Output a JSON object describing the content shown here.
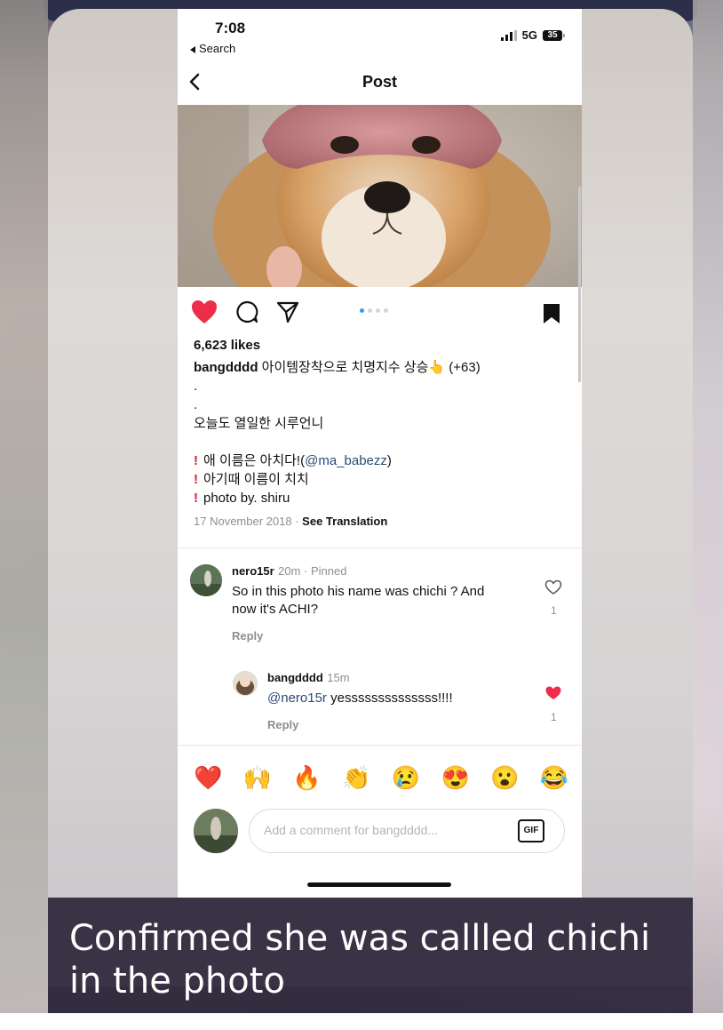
{
  "status_bar": {
    "time": "7:08",
    "back_app": "Search",
    "network": "5G",
    "battery": "35"
  },
  "nav": {
    "title": "Post"
  },
  "post": {
    "likes": "6,623 likes",
    "carousel": {
      "count": 4,
      "active_index": 0
    },
    "liked": true,
    "caption": {
      "username": "bangdddd",
      "text": "아이템장착으로 치명지수 상승",
      "emoji": "👆",
      "suffix": "(+63)",
      "dot1": ".",
      "dot2": ".",
      "line2": "오늘도 열일한 시루언니",
      "bullet1_prefix": "애 이름은 아치다!(",
      "bullet1_mention": "@ma_babezz",
      "bullet1_suffix": ")",
      "bullet2": "아기때 이름이 치치",
      "bullet3": "photo by. shiru",
      "bullet_mark": "!"
    },
    "date": "17 November 2018",
    "date_separator": "·",
    "see_translation": "See Translation"
  },
  "comments": [
    {
      "username": "nero15r",
      "meta": "20m · Pinned",
      "text_line1": "So in this photo his name was chichi ? And",
      "text_line2": "now it's ACHI?",
      "reply": "Reply",
      "likes": "1",
      "liked": false
    },
    {
      "username": "bangdddd",
      "meta": "15m",
      "mention": "@nero15r",
      "text": "yessssssssssssss!!!!",
      "reply": "Reply",
      "likes": "1",
      "liked": true
    }
  ],
  "emoji_bar": [
    "❤️",
    "🙌",
    "🔥",
    "👏",
    "😢",
    "😍",
    "😮",
    "😂"
  ],
  "composer": {
    "placeholder": "Add a comment for bangdddd...",
    "gif_label": "GIF"
  },
  "overlay_caption": "Confirmed she was callled chichi in the photo",
  "colors": {
    "heart": "#ed2d4a",
    "link": "#2b4a7a",
    "muted": "#8e8e8e",
    "caption_bar": "#2d263a"
  }
}
